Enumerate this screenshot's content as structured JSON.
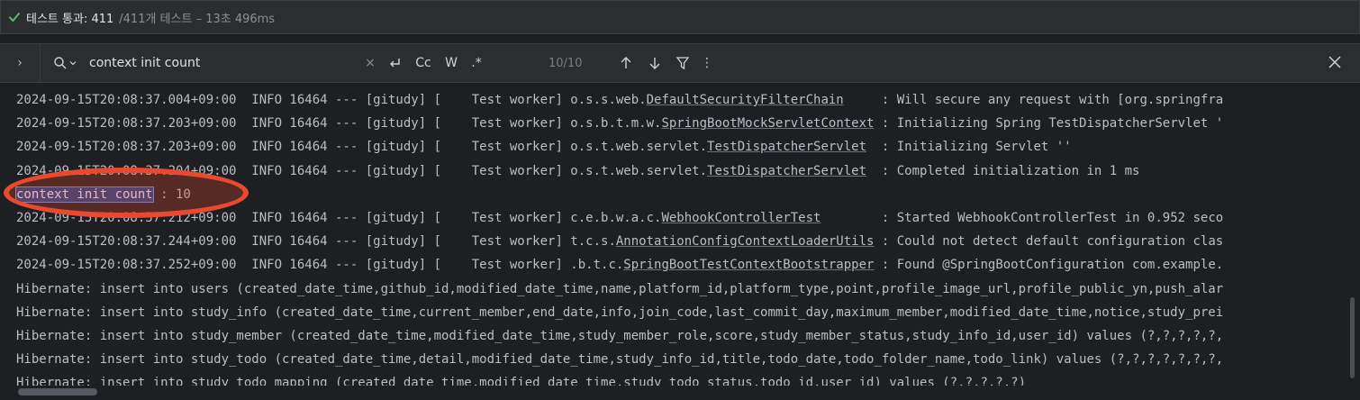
{
  "status": {
    "passed_label": "테스트 통과: 411",
    "total_label": "/411개 테스트 – 13초 496ms"
  },
  "search": {
    "query": "context init count",
    "match_count": "10/10",
    "option_case": "Cc",
    "option_words": "W",
    "option_regex": ".*"
  },
  "console": {
    "lines": [
      {
        "prefix": "2024-09-15T20:08:37.004+09:00  INFO 16464 --- [gitudy] [    Test worker] o.s.s.web.",
        "cls": "DefaultSecurityFilterChain",
        "suffix": "     : Will secure any request with [org.springfra"
      },
      {
        "prefix": "2024-09-15T20:08:37.203+09:00  INFO 16464 --- [gitudy] [    Test worker] o.s.b.t.m.w.",
        "cls": "SpringBootMockServletContext",
        "suffix": " : Initializing Spring TestDispatcherServlet '"
      },
      {
        "prefix": "2024-09-15T20:08:37.203+09:00  INFO 16464 --- [gitudy] [    Test worker] o.s.t.web.servlet.",
        "cls": "TestDispatcherServlet",
        "suffix": "  : Initializing Servlet ''"
      },
      {
        "prefix": "2024-09-15T20:08:37.204+09:00  INFO 16464 --- [gitudy] [    Test worker] o.s.t.web.servlet.",
        "cls": "TestDispatcherServlet",
        "suffix": "  : Completed initialization in 1 ms"
      },
      {
        "match": "context init count",
        "after": " : 10"
      },
      {
        "prefix": "2024-09-15T20:08:37.212+09:00  INFO 16464 --- [gitudy] [    Test worker] c.e.b.w.a.c.",
        "cls": "WebhookControllerTest",
        "suffix": "        : Started WebhookControllerTest in 0.952 seco"
      },
      {
        "prefix": "2024-09-15T20:08:37.244+09:00  INFO 16464 --- [gitudy] [    Test worker] t.c.s.",
        "cls": "AnnotationConfigContextLoaderUtils",
        "suffix": " : Could not detect default configuration clas"
      },
      {
        "prefix": "2024-09-15T20:08:37.252+09:00  INFO 16464 --- [gitudy] [    Test worker] .b.t.c.",
        "cls": "SpringBootTestContextBootstrapper",
        "suffix": " : Found @SpringBootConfiguration com.example."
      },
      {
        "text": "Hibernate: insert into users (created_date_time,github_id,modified_date_time,name,platform_id,platform_type,point,profile_image_url,profile_public_yn,push_alar"
      },
      {
        "text": "Hibernate: insert into study_info (created_date_time,current_member,end_date,info,join_code,last_commit_day,maximum_member,modified_date_time,notice,study_prei"
      },
      {
        "text": "Hibernate: insert into study_member (created_date_time,modified_date_time,study_member_role,score,study_member_status,study_info_id,user_id) values (?,?,?,?,?,"
      },
      {
        "text": "Hibernate: insert into study_todo (created_date_time,detail,modified_date_time,study_info_id,title,todo_date,todo_folder_name,todo_link) values (?,?,?,?,?,?,?,"
      },
      {
        "text": "Hibernate: insert into study_todo_mapping (created_date_time,modified_date_time,study_todo_status,todo_id,user_id) values (?,?,?,?,?)"
      }
    ]
  },
  "colors": {
    "accent_pass": "#5fb865",
    "highlight": "#214283",
    "annotation": "#e9492f"
  }
}
